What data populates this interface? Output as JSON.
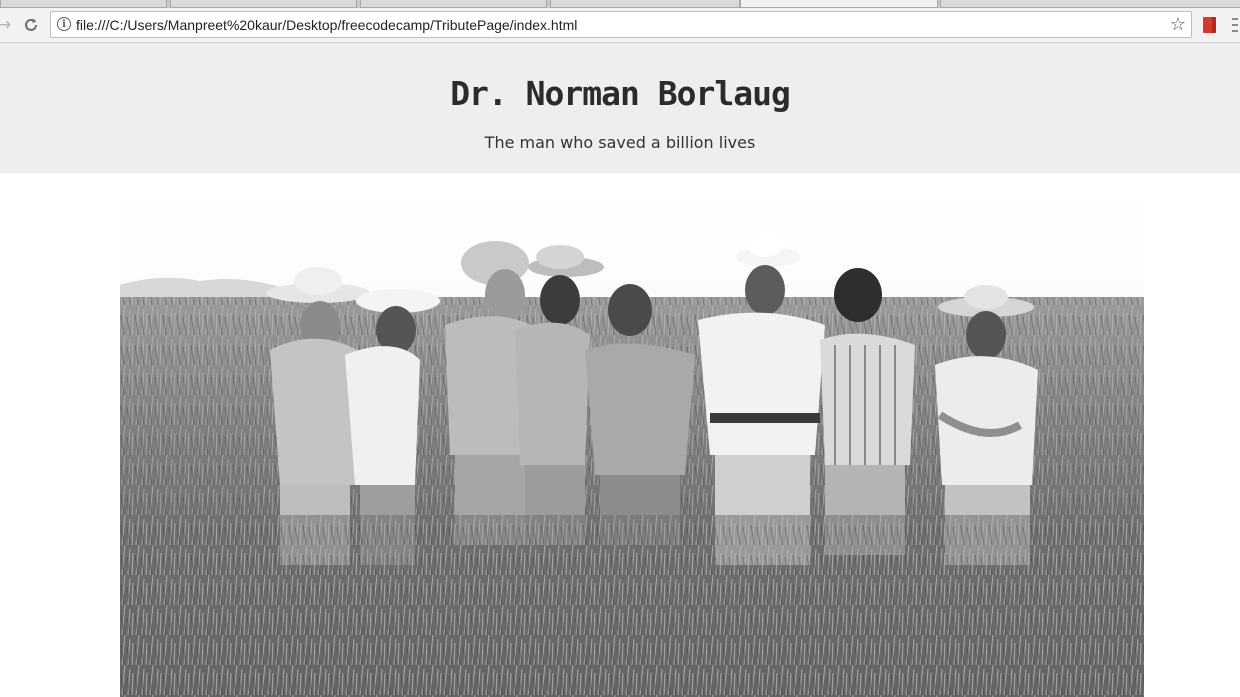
{
  "browser": {
    "address_bar": {
      "url": "file:///C:/Users/Manpreet%20kaur/Desktop/freecodecamp/TributePage/index.html"
    },
    "icons": [
      "back-arrow-icon",
      "reload-icon",
      "info-icon",
      "star-icon",
      "extension-icon",
      "menu-icon"
    ]
  },
  "page": {
    "title": "Dr. Norman Borlaug",
    "subtitle": "The man who saved a billion lives",
    "colors": {
      "header_background": "#eeeeee",
      "page_background": "#ffffff",
      "text": "#2b2b2b"
    },
    "hero_image": {
      "style": "black-and-white photograph",
      "content": "group-of-men-in-wheat-field"
    }
  }
}
